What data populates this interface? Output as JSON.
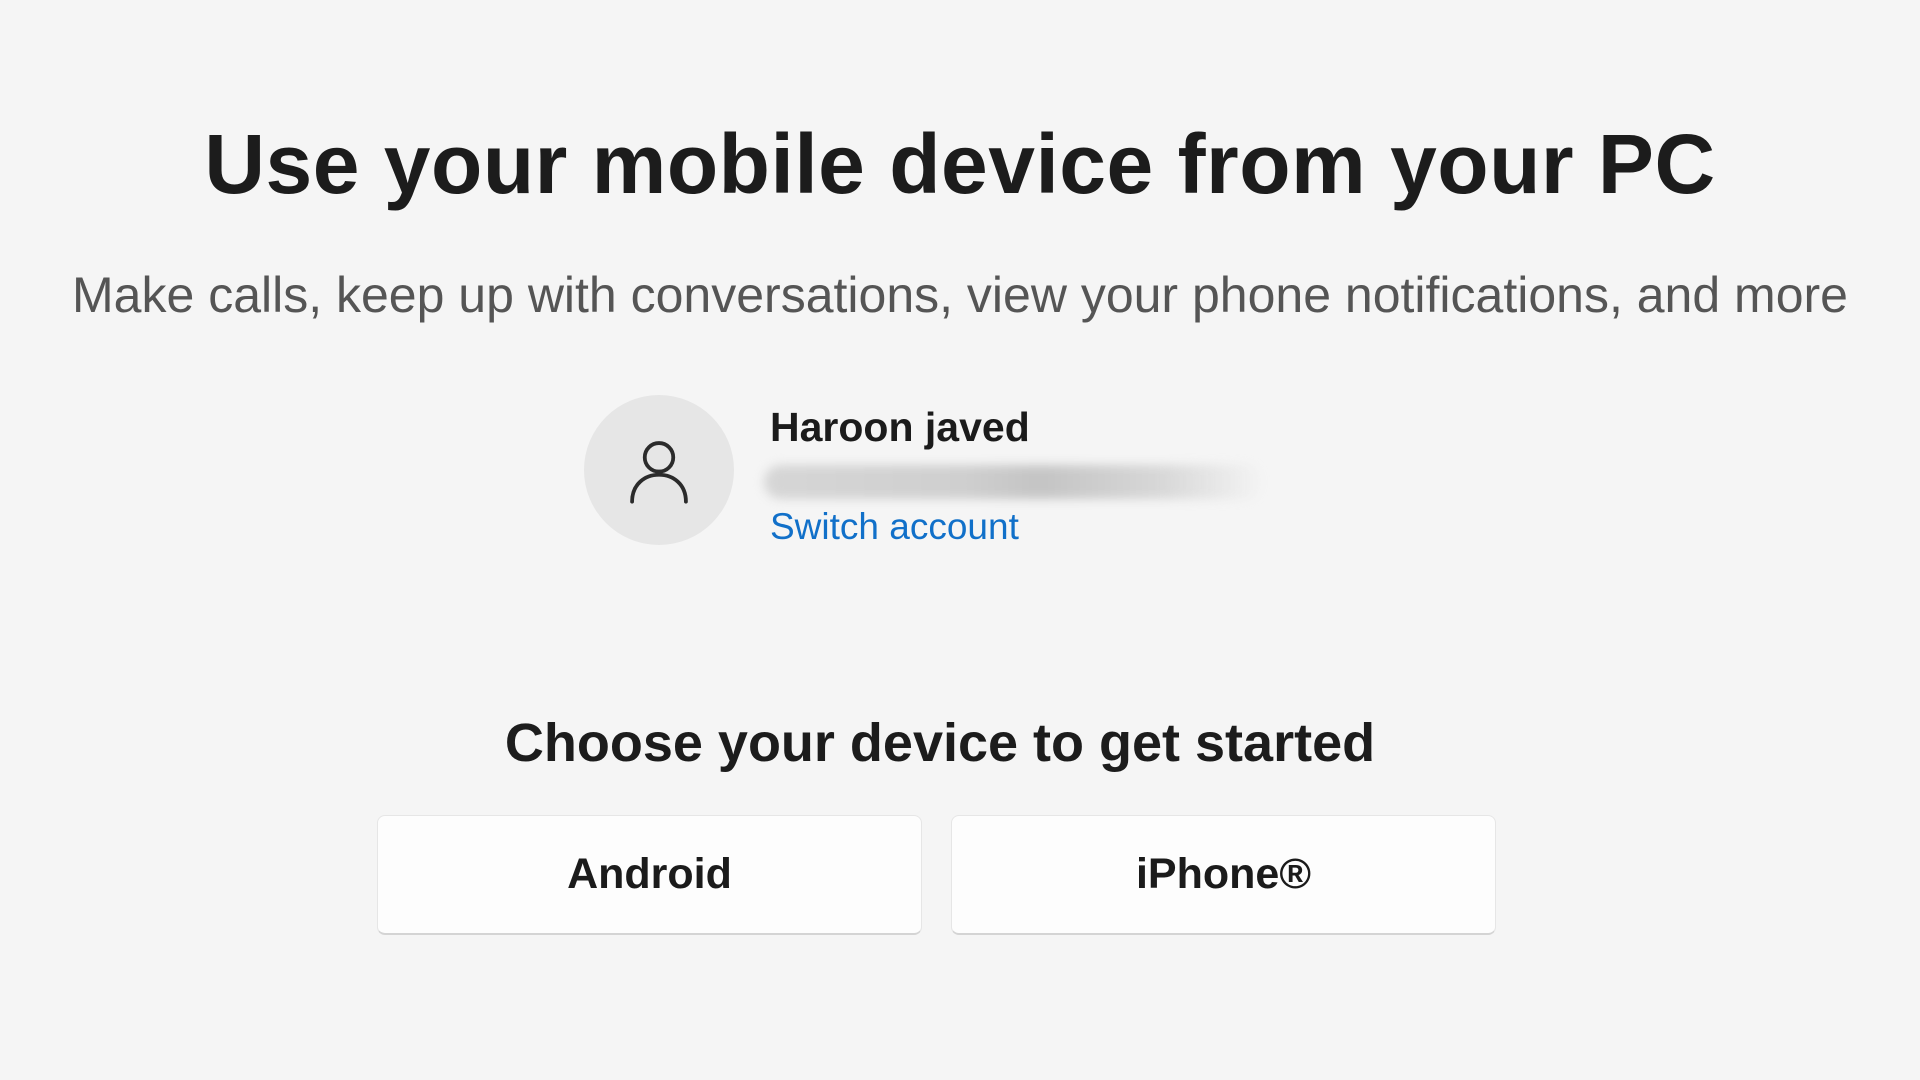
{
  "header": {
    "title": "Use your mobile device from your PC",
    "subtitle": "Make calls, keep up with conversations, view your phone notifications, and more"
  },
  "account": {
    "name": "Haroon javed",
    "switch_label": "Switch account",
    "avatar_icon": "person-icon"
  },
  "device_section": {
    "heading": "Choose your device to get started",
    "options": [
      {
        "label": "Android"
      },
      {
        "label": "iPhone®"
      }
    ]
  },
  "colors": {
    "background": "#f5f5f5",
    "link": "#1170c9",
    "avatar_bg": "#e6e6e6"
  }
}
